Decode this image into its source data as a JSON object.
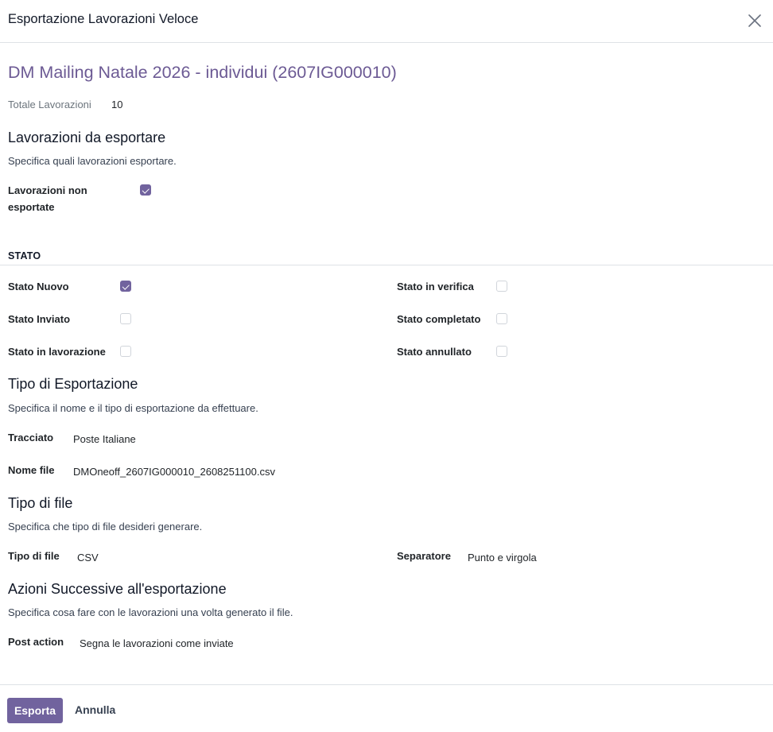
{
  "dialog": {
    "title": "Esportazione Lavorazioni Veloce"
  },
  "record": {
    "title": "DM Mailing Natale 2026 - individui (2607IG000010)",
    "totale_label": "Totale Lavorazioni",
    "totale_value": "10"
  },
  "lavorazioni": {
    "title": "Lavorazioni da esportare",
    "desc": "Specifica quali lavorazioni esportare.",
    "non_esportate_label_line1": "Lavorazioni non",
    "non_esportate_label_line2": "esportate",
    "non_esportate_checked": true
  },
  "stato": {
    "group_title": "STATO",
    "items": [
      {
        "label": "Stato Nuovo",
        "checked": true
      },
      {
        "label": "Stato Inviato",
        "checked": false
      },
      {
        "label": "Stato in lavorazione",
        "checked": false
      },
      {
        "label": "Stato in verifica",
        "checked": false
      },
      {
        "label": "Stato completato",
        "checked": false
      },
      {
        "label": "Stato annullato",
        "checked": false
      }
    ]
  },
  "tipo_esportazione": {
    "title": "Tipo di Esportazione",
    "desc": "Specifica il nome e il tipo di esportazione da effettuare.",
    "tracciato_label": "Tracciato",
    "tracciato_value": "Poste Italiane",
    "nome_file_label": "Nome file",
    "nome_file_value": "DMOneoff_2607IG000010_2608251100.csv"
  },
  "tipo_file": {
    "title": "Tipo di file",
    "desc": "Specifica che tipo di file desideri generare.",
    "tipo_label": "Tipo di file",
    "tipo_value": "CSV",
    "separatore_label": "Separatore",
    "separatore_value": "Punto e virgola"
  },
  "azioni": {
    "title": "Azioni Successive all'esportazione",
    "desc": "Specifica cosa fare con le lavorazioni una volta generato il file.",
    "post_action_label": "Post action",
    "post_action_value": "Segna le lavorazioni come inviate"
  },
  "footer": {
    "primary_label": "Esporta",
    "secondary_label": "Annulla"
  },
  "colors": {
    "primary": "#71639e",
    "title": "#6c5a94"
  },
  "icons": {
    "close": "close-icon",
    "check": "check-icon"
  }
}
